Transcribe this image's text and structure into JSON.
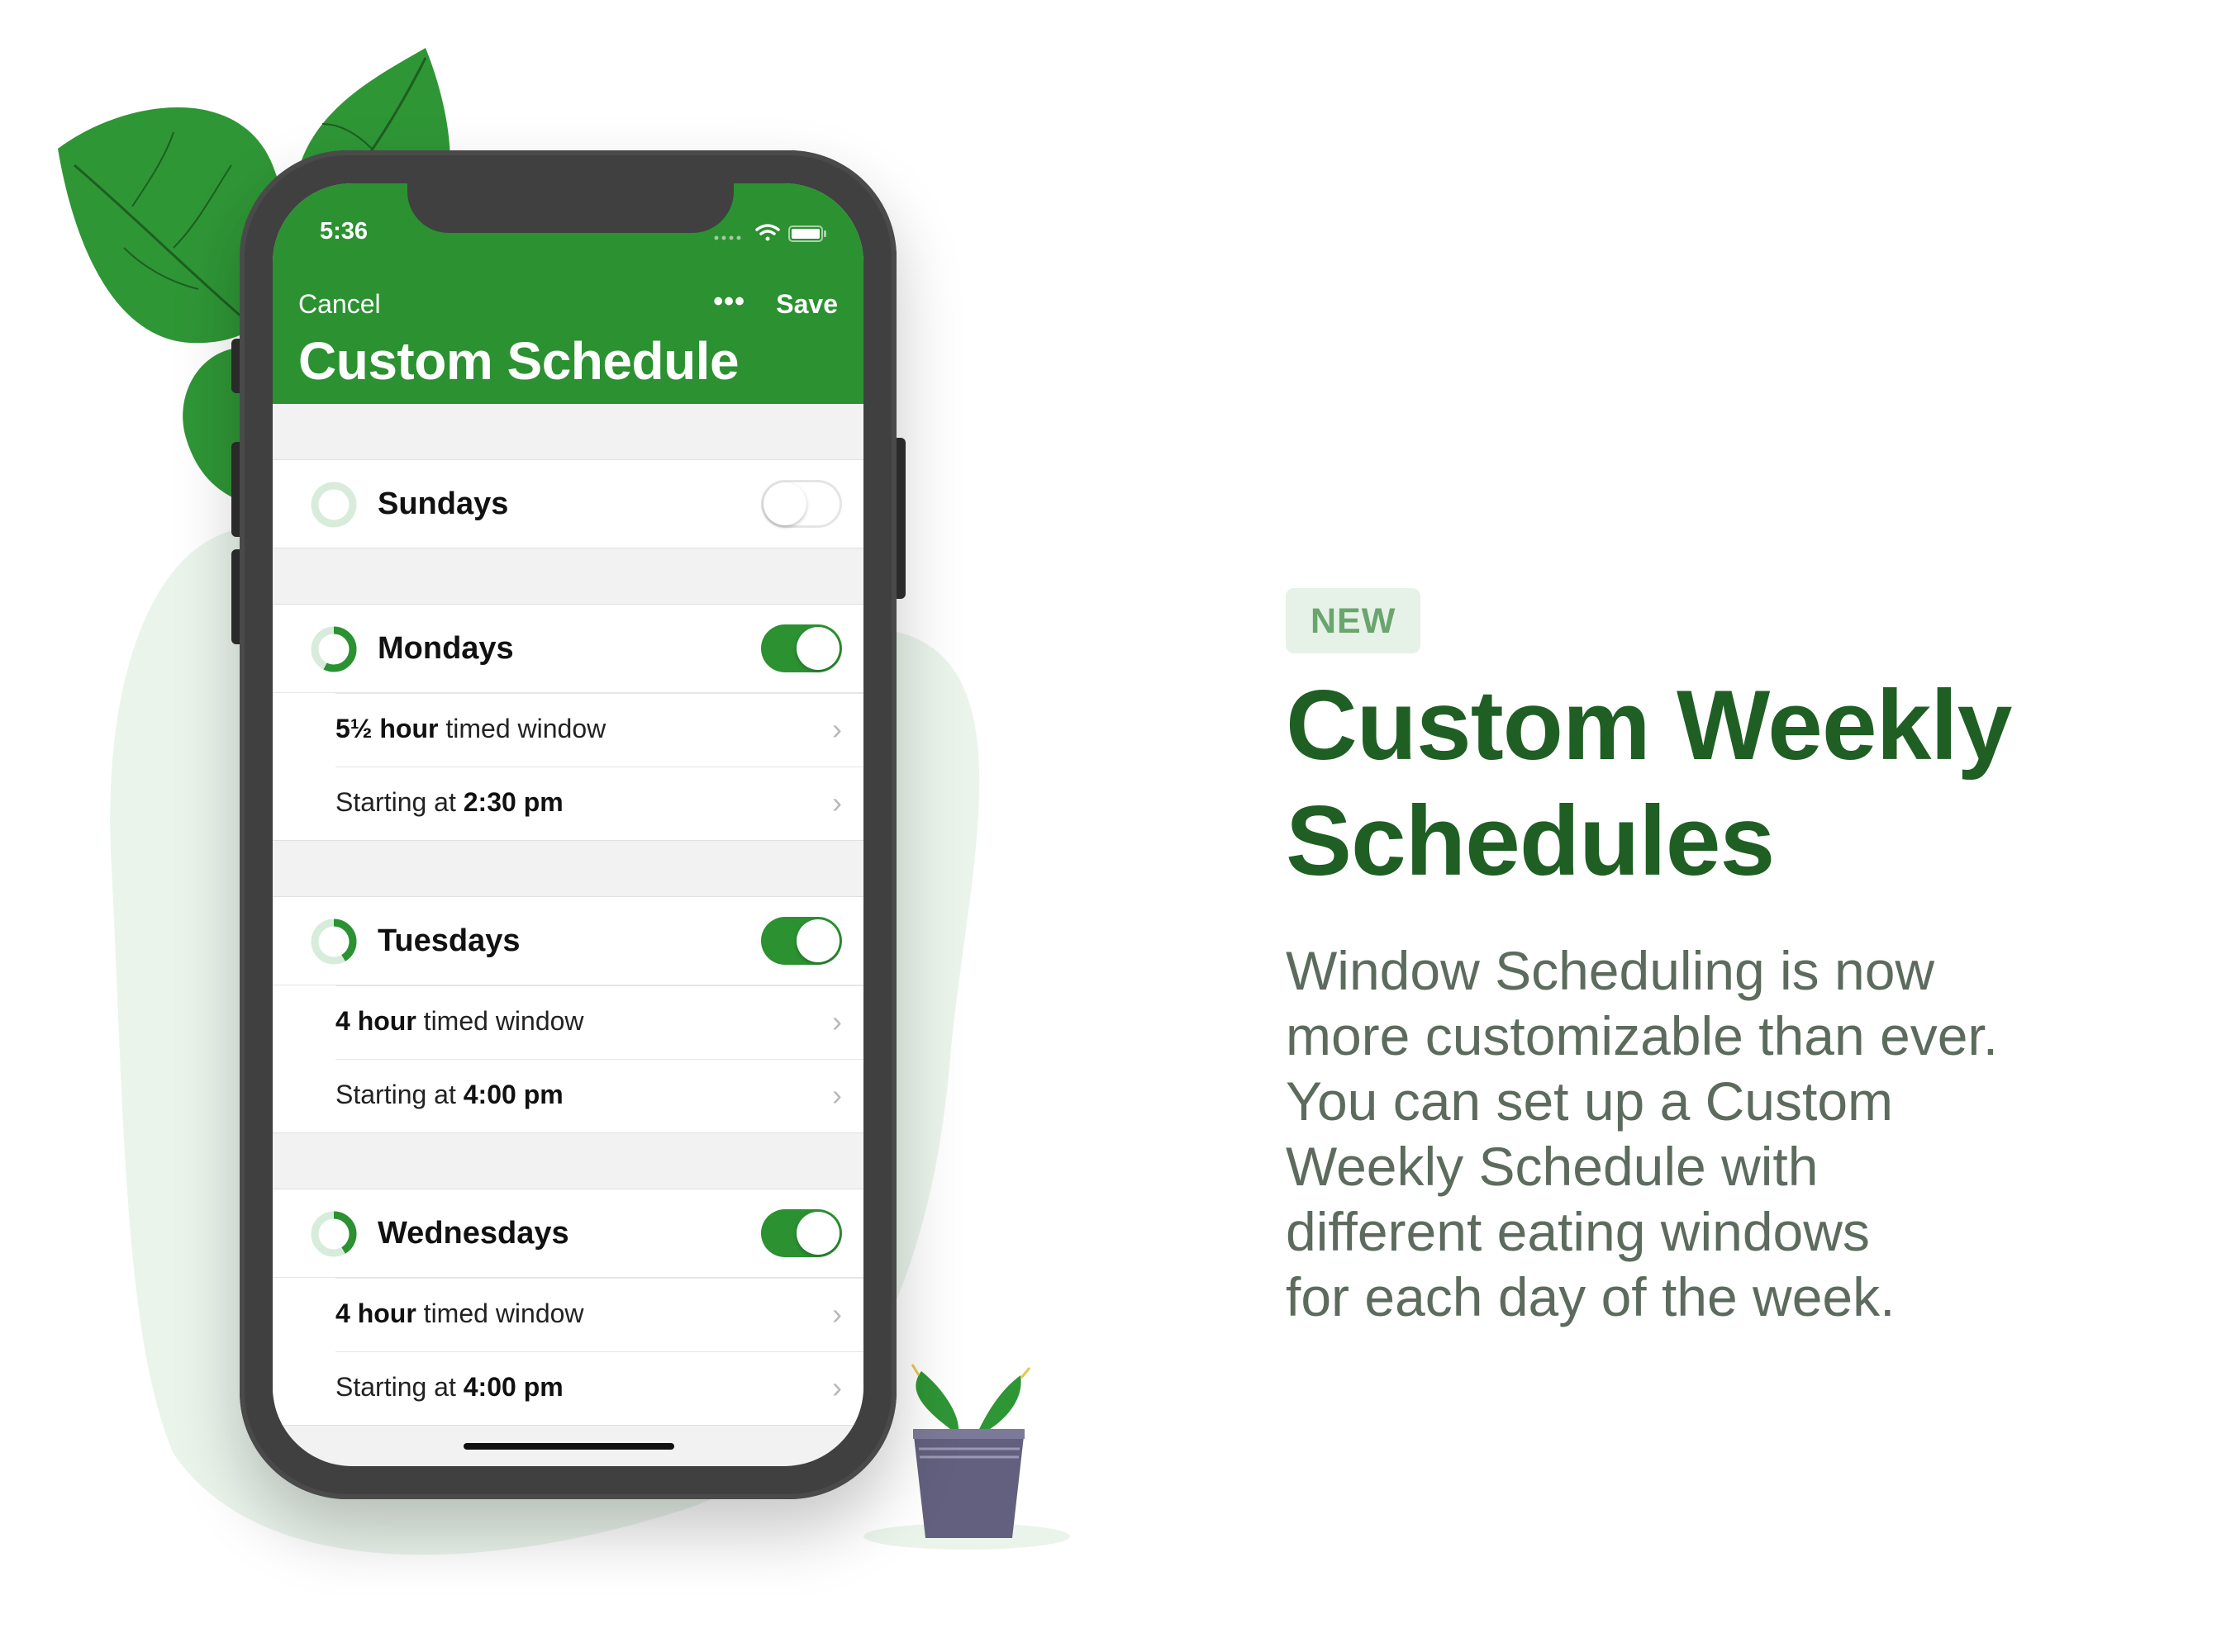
{
  "phone": {
    "status_time": "5:36",
    "nav": {
      "cancel_label": "Cancel",
      "more_label": "•••",
      "save_label": "Save",
      "title": "Custom Schedule"
    },
    "days": [
      {
        "label": "Sundays",
        "enabled": false
      },
      {
        "label": "Mondays",
        "enabled": true,
        "window_bold": "5½ hour",
        "window_text": " timed window",
        "start_text": "Starting at ",
        "start_bold": "2:30 pm"
      },
      {
        "label": "Tuesdays",
        "enabled": true,
        "window_bold": "4 hour",
        "window_text": " timed window",
        "start_text": "Starting at ",
        "start_bold": "4:00 pm"
      },
      {
        "label": "Wednesdays",
        "enabled": true,
        "window_bold": "4 hour",
        "window_text": " timed window",
        "start_text": "Starting at ",
        "start_bold": "4:00 pm"
      }
    ],
    "chevron": "›"
  },
  "promo": {
    "badge": "NEW",
    "headline_line1": "Custom Weekly",
    "headline_line2": "Schedules",
    "body": "Window Scheduling is now\nmore customizable than ever.\nYou can set up a Custom\nWeekly Schedule with\ndifferent eating windows\n for each day of the week."
  },
  "colors": {
    "brand_green": "#2b9131",
    "headline_green": "#1f5f24",
    "body_gray": "#5c6b5d",
    "badge_bg": "#e6f2e7",
    "badge_text": "#6aa56e"
  },
  "icons": {
    "decor_leaves": "leaf-icon",
    "decor_plant": "potted-plant-icon",
    "status": [
      "cellular-icon",
      "wifi-icon",
      "battery-icon"
    ]
  }
}
